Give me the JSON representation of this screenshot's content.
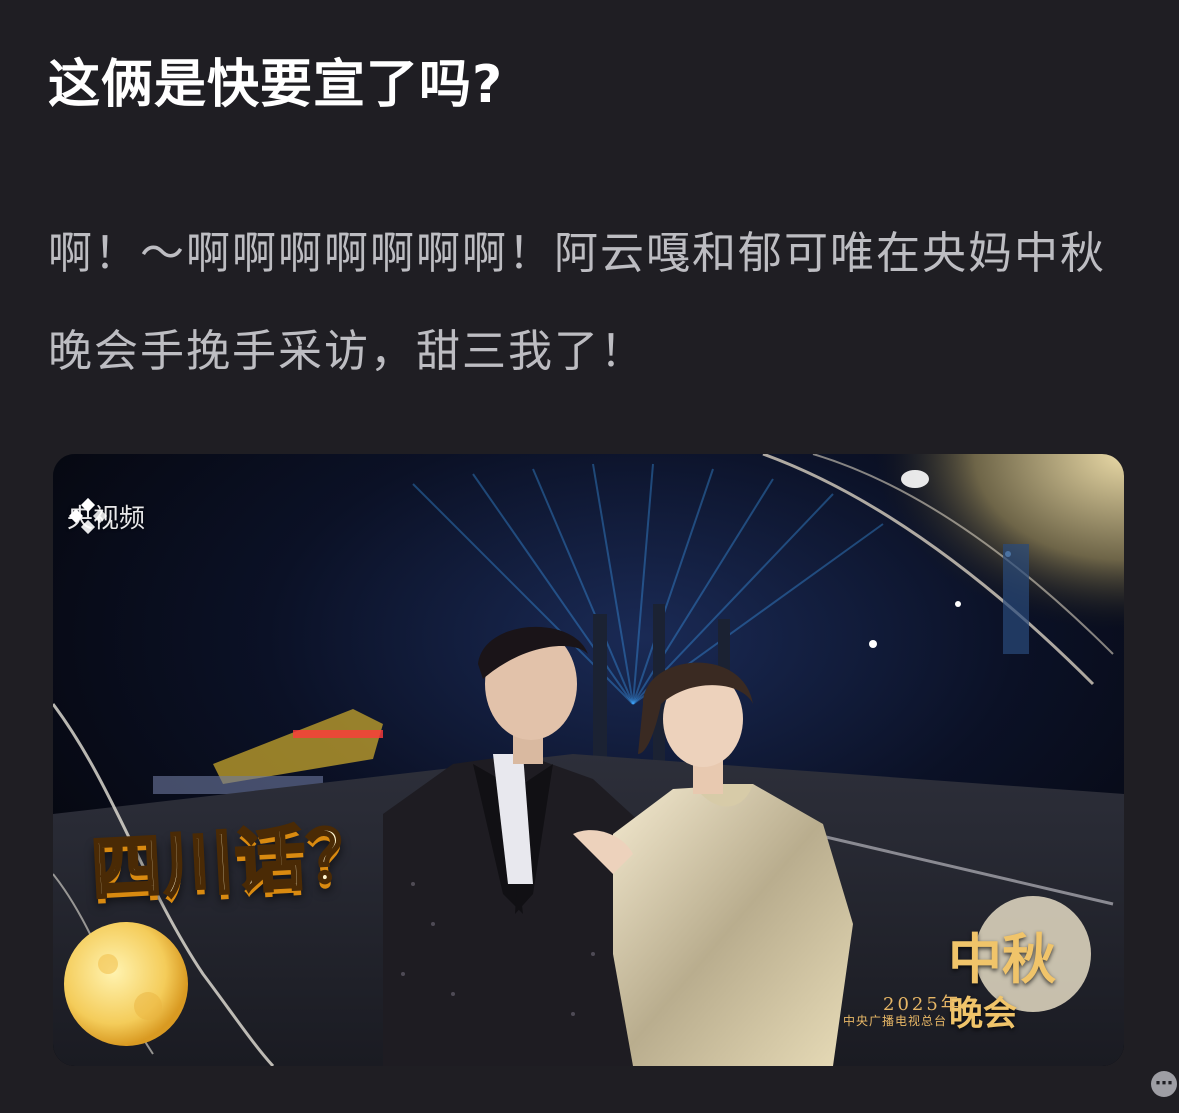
{
  "post": {
    "title": "这俩是快要宣了吗?",
    "body": "啊！～啊啊啊啊啊啊啊！阿云嘎和郁可唯在央妈中秋晚会手挽手采访，甜三我了！"
  },
  "media": {
    "watermark_icon": "cctv-video-logo-icon",
    "watermark_text": "央视频",
    "caption": "四川话？",
    "event_logo_main": "中秋",
    "event_logo_sub": "晚会",
    "event_year": "2025年",
    "event_org": "中央广播电视总台"
  },
  "colors": {
    "background": "#1f1e23",
    "title": "#ffffff",
    "body": "#bdbdc2",
    "caption_gold": "#d98a10"
  },
  "icons": {
    "more": "more-icon"
  }
}
